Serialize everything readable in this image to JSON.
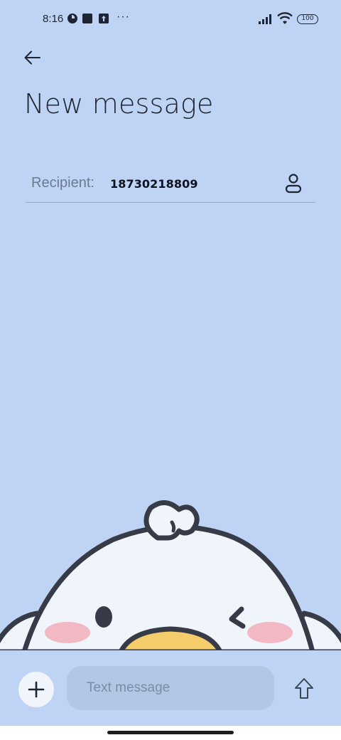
{
  "status_bar": {
    "time": "8:16",
    "icons": [
      "app-notification-icon",
      "square-app-icon",
      "upload-app-icon"
    ],
    "more_indicator": "···",
    "battery_level": "100",
    "signal_icon": "cellular-signal-icon",
    "wifi_icon": "wifi-icon"
  },
  "header": {
    "back_icon": "arrow-left-icon",
    "title": "New message"
  },
  "recipient": {
    "label": "Recipient:",
    "value": "18730218809",
    "contact_icon": "person-icon"
  },
  "compose": {
    "attach_icon": "plus-icon",
    "placeholder": "Text message",
    "send_icon": "arrow-up-icon"
  },
  "colors": {
    "background": "#bfd4f4",
    "input_background": "#b2c7e6",
    "mascot_body": "#f0f5fc",
    "mascot_outline": "#363b47",
    "mascot_beak": "#f4cd6a",
    "mascot_cheek": "#f2b8c4"
  }
}
